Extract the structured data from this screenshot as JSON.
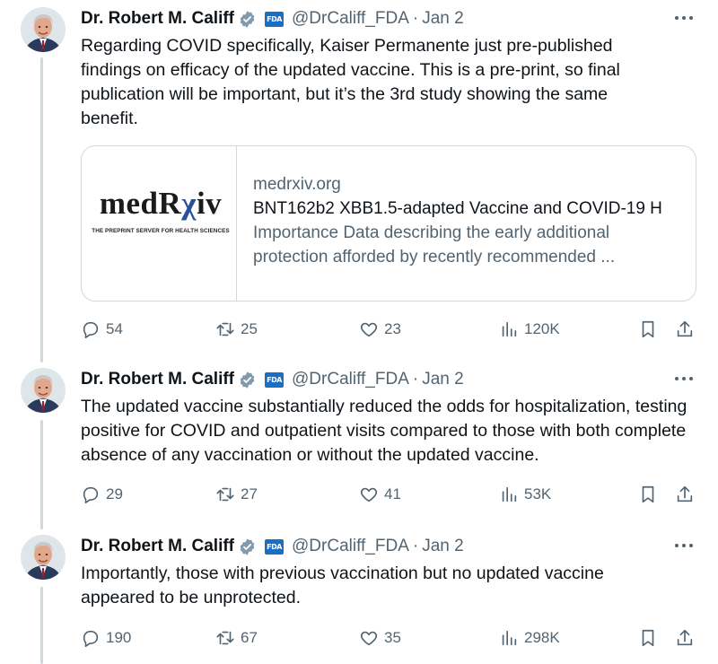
{
  "tweets": [
    {
      "author": {
        "name": "Dr. Robert M. Califf",
        "badge": "FDA",
        "handle": "@DrCaliff_FDA",
        "date": "Jan 2"
      },
      "text": "Regarding COVID specifically, Kaiser Permanente just pre-published findings on efficacy of the updated vaccine. This is a pre-print, so final publication will be important, but it’s the 3rd study showing the same benefit.",
      "card": {
        "logo_text_main": "medR",
        "logo_text_r": "χ",
        "logo_text_end": "iv",
        "logo_subtitle": "THE PREPRINT SERVER FOR HEALTH SCIENCES",
        "domain": "medrxiv.org",
        "title": "BNT162b2 XBB1.5-adapted Vaccine and COVID-19 H",
        "description": "Importance Data describing the early additional protection afforded by recently recommended ..."
      },
      "stats": {
        "replies": "54",
        "reposts": "25",
        "likes": "23",
        "views": "120K"
      }
    },
    {
      "author": {
        "name": "Dr. Robert M. Califf",
        "badge": "FDA",
        "handle": "@DrCaliff_FDA",
        "date": "Jan 2"
      },
      "text": "The updated vaccine substantially reduced the odds for hospitalization, testing positive for COVID and outpatient visits compared to those with both complete absence of any vaccination or without the updated vaccine.",
      "stats": {
        "replies": "29",
        "reposts": "27",
        "likes": "41",
        "views": "53K"
      }
    },
    {
      "author": {
        "name": "Dr. Robert M. Califf",
        "badge": "FDA",
        "handle": "@DrCaliff_FDA",
        "date": "Jan 2"
      },
      "text": "Importantly, those with previous vaccination but no updated vaccine appeared to be unprotected.",
      "stats": {
        "replies": "190",
        "reposts": "67",
        "likes": "35",
        "views": "298K"
      }
    }
  ],
  "colors": {
    "text_primary": "#0f1419",
    "text_secondary": "#536471",
    "verified": "#829aab",
    "fda_blue": "#1a6fc4",
    "border": "#cfd9de",
    "medrxiv_r": "#2b4f9a"
  },
  "icons": [
    "reply-icon",
    "repost-icon",
    "like-icon",
    "views-icon",
    "bookmark-icon",
    "share-icon",
    "more-icon",
    "verified-icon"
  ]
}
